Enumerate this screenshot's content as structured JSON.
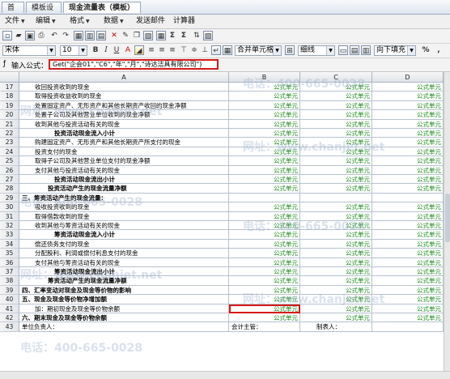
{
  "tabs": [
    {
      "label": "首页",
      "active": false
    },
    {
      "label": "模板设计",
      "active": false
    },
    {
      "label": "现金流量表（模板）",
      "active": true
    }
  ],
  "menu": [
    "文件",
    "编辑",
    "格式",
    "数据",
    "发送邮件",
    "计算器"
  ],
  "toolbar": {
    "font": "宋体",
    "size": "10",
    "bold": "B",
    "italic": "I",
    "underline": "U",
    "merge": "合并单元格",
    "border": "细线",
    "fill": "向下填充",
    "percent": "%"
  },
  "formula": {
    "label": "输入公式：",
    "value": "Get(\"企会01\",\"C6\",\"年\",\"月\",\"诗达洁具有限公司\")"
  },
  "columns": [
    "A",
    "B",
    "C",
    "D"
  ],
  "formula_cell": "公式单元",
  "rows": [
    {
      "n": "17",
      "a": "收回投资收到的现金",
      "indent": 2,
      "bold": false,
      "f": true
    },
    {
      "n": "18",
      "a": "取得投资收益收到的现金",
      "indent": 2,
      "bold": false,
      "f": true
    },
    {
      "n": "19",
      "a": "处置固定资产、无形资产和其他长期资产收回的现金净额",
      "indent": 2,
      "bold": false,
      "f": true
    },
    {
      "n": "20",
      "a": "处置子公司及其他营业单位收到的现金净额",
      "indent": 2,
      "bold": false,
      "f": true
    },
    {
      "n": "21",
      "a": "收到其他与投资活动有关的现金",
      "indent": 2,
      "bold": false,
      "f": true
    },
    {
      "n": "22",
      "a": "投资活动现金流入小计",
      "indent": 5,
      "bold": true,
      "f": true
    },
    {
      "n": "23",
      "a": "购建固定资产、无形资产和其他长期资产所支付的现金",
      "indent": 2,
      "bold": false,
      "f": true
    },
    {
      "n": "24",
      "a": "投资支付的现金",
      "indent": 2,
      "bold": false,
      "f": true
    },
    {
      "n": "25",
      "a": "取得子公司及其他营业单位支付的现金净额",
      "indent": 2,
      "bold": false,
      "f": true
    },
    {
      "n": "26",
      "a": "支付其他与投资活动有关的现金",
      "indent": 2,
      "bold": false,
      "f": true
    },
    {
      "n": "27",
      "a": "投资活动现金流出小计",
      "indent": 5,
      "bold": true,
      "f": true
    },
    {
      "n": "28",
      "a": "投资活动产生的现金流量净额",
      "indent": 4,
      "bold": true,
      "f": true
    },
    {
      "n": "29",
      "a": "三、筹资活动产生的现金流量：",
      "indent": 0,
      "bold": true,
      "f": false
    },
    {
      "n": "30",
      "a": "吸收投资收到的现金",
      "indent": 2,
      "bold": false,
      "f": true
    },
    {
      "n": "31",
      "a": "取得借款收到的现金",
      "indent": 2,
      "bold": false,
      "f": true
    },
    {
      "n": "32",
      "a": "收到其他与筹资活动有关的现金",
      "indent": 2,
      "bold": false,
      "f": true
    },
    {
      "n": "33",
      "a": "筹资活动现金流入小计",
      "indent": 5,
      "bold": true,
      "f": true
    },
    {
      "n": "34",
      "a": "偿还债务支付的现金",
      "indent": 2,
      "bold": false,
      "f": true
    },
    {
      "n": "35",
      "a": "分配股利、利润或偿付利息支付的现金",
      "indent": 2,
      "bold": false,
      "f": true
    },
    {
      "n": "36",
      "a": "支付其他与筹资活动有关的现金",
      "indent": 2,
      "bold": false,
      "f": true
    },
    {
      "n": "37",
      "a": "筹资活动现金流出小计",
      "indent": 5,
      "bold": true,
      "f": true
    },
    {
      "n": "38",
      "a": "筹资活动产生的现金流量净额",
      "indent": 4,
      "bold": true,
      "f": true
    },
    {
      "n": "39",
      "a": "四、汇率变动对现金及现金等价物的影响",
      "indent": 0,
      "bold": true,
      "f": true
    },
    {
      "n": "40",
      "a": "五、现金及现金等价物净增加额",
      "indent": 0,
      "bold": true,
      "f": true
    },
    {
      "n": "41",
      "a": "加：期初现金及现金等价物余额",
      "indent": 2,
      "bold": false,
      "f": true,
      "selected_b": true
    },
    {
      "n": "42",
      "a": "六、期末现金及现金等价物余额",
      "indent": 0,
      "bold": true,
      "f": true
    }
  ],
  "footer": {
    "n": "43",
    "a": "单位负责人：",
    "b": "会计主管：",
    "c": "制表人："
  },
  "watermarks": [
    "电话：400-665-0028",
    "网址：www.chanjet.net"
  ]
}
